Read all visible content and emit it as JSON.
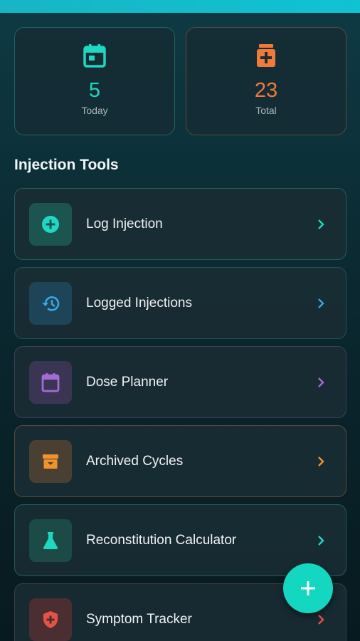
{
  "colors": {
    "accent_teal": "#1fd8c2",
    "accent_orange": "#f07a3a",
    "accent_blue": "#3aa6e6",
    "accent_purple": "#a46bd6",
    "accent_amber": "#f0922e",
    "accent_red": "#e5524a"
  },
  "stats": {
    "today": {
      "value": "5",
      "label": "Today",
      "icon": "calendar-icon"
    },
    "total": {
      "value": "23",
      "label": "Total",
      "icon": "medical-bag-icon"
    }
  },
  "section": {
    "title": "Injection Tools"
  },
  "tools": [
    {
      "label": "Log Injection",
      "icon": "add-circle-icon"
    },
    {
      "label": "Logged Injections",
      "icon": "history-icon"
    },
    {
      "label": "Dose Planner",
      "icon": "calendar-icon"
    },
    {
      "label": "Archived Cycles",
      "icon": "archive-icon"
    },
    {
      "label": "Reconstitution Calculator",
      "icon": "flask-icon"
    },
    {
      "label": "Symptom Tracker",
      "icon": "shield-plus-icon"
    }
  ],
  "fab": {
    "icon": "plus-icon"
  }
}
